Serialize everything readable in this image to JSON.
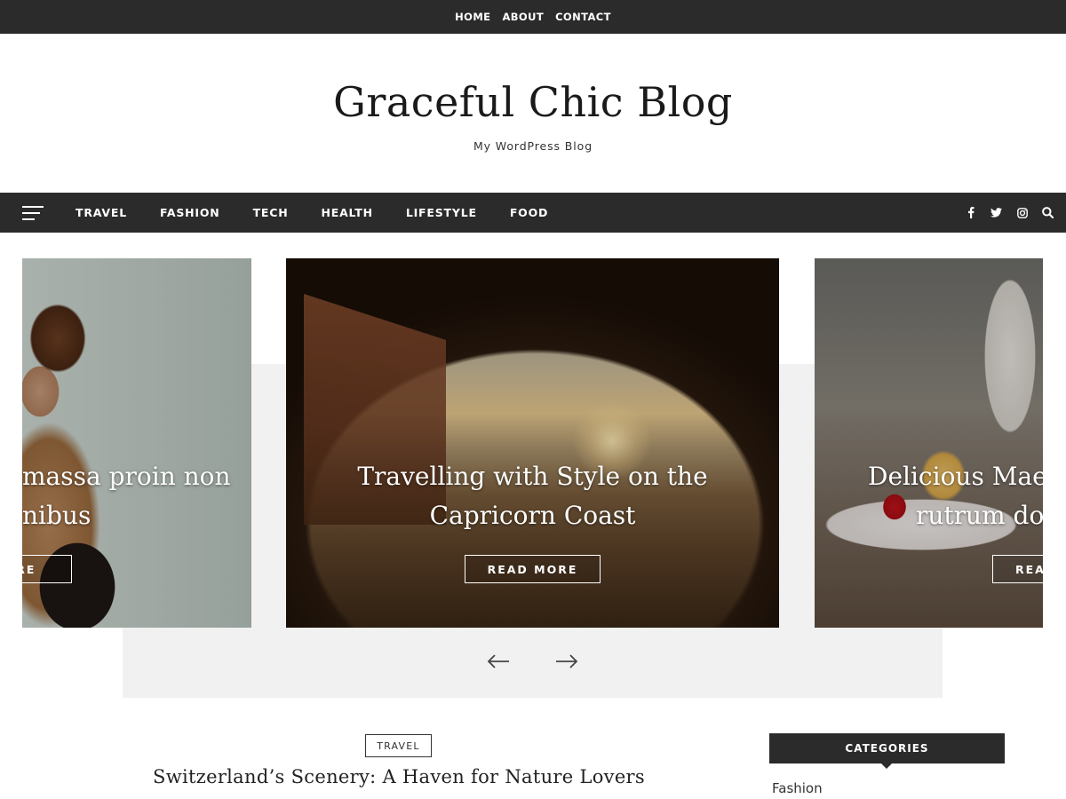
{
  "topbar": {
    "links": [
      "HOME",
      "ABOUT",
      "CONTACT"
    ]
  },
  "header": {
    "title": "Graceful Chic Blog",
    "tagline": "My WordPress Blog"
  },
  "mainnav": {
    "items": [
      "TRAVEL",
      "FASHION",
      "TECH",
      "HEALTH",
      "LIFESTYLE",
      "FOOD"
    ],
    "icons": [
      "menu-icon",
      "facebook-icon",
      "twitter-icon",
      "instagram-icon",
      "search-icon"
    ]
  },
  "slider": {
    "slides": [
      {
        "title_line1": "massa proin non",
        "title_line2": "nibus",
        "button": "ORE"
      },
      {
        "title_line1": "Travelling with Style on the",
        "title_line2": "Capricorn Coast",
        "button": "READ MORE"
      },
      {
        "title_line1": "Delicious Maec",
        "title_line2": "rutrum dol",
        "button": "REA"
      }
    ],
    "prev_icon": "arrow-left-icon",
    "next_icon": "arrow-right-icon"
  },
  "post": {
    "category": "TRAVEL",
    "title": "Switzerland’s Scenery: A Haven for Nature Lovers"
  },
  "sidebar": {
    "widget_title": "CATEGORIES",
    "categories": [
      "Fashion"
    ]
  },
  "colors": {
    "dark_bar": "#2b2b2b",
    "slider_bg": "#f1f1f1",
    "text": "#222222"
  }
}
